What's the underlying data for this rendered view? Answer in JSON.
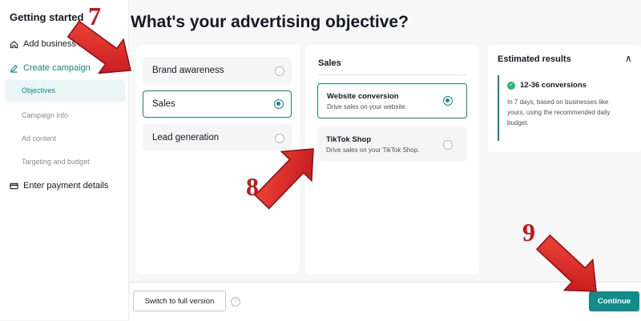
{
  "sidebar": {
    "title": "Getting started",
    "steps": [
      {
        "label": "Add business info",
        "icon": "home-icon"
      },
      {
        "label": "Create campaign",
        "icon": "pencil-icon"
      },
      {
        "label": "Enter payment details",
        "icon": "card-icon"
      }
    ],
    "substeps": [
      "Objectives",
      "Campaign info",
      "Ad content",
      "Targeting and budget"
    ]
  },
  "page": {
    "title": "What's your advertising objective?"
  },
  "objectives": {
    "options": [
      {
        "label": "Brand awareness",
        "selected": false
      },
      {
        "label": "Sales",
        "selected": true
      },
      {
        "label": "Lead generation",
        "selected": false
      }
    ]
  },
  "sales_panel": {
    "title": "Sales",
    "options": [
      {
        "title": "Website conversion",
        "desc": "Drive sales on your website.",
        "selected": true
      },
      {
        "title": "TikTok Shop",
        "desc": "Drive sales on your TikTok Shop.",
        "selected": false
      }
    ]
  },
  "estimated": {
    "title": "Estimated results",
    "head": "12-36 conversions",
    "desc": "In 7 days, based on businesses like yours, using the recommended daily budget."
  },
  "footer": {
    "switch_label": "Switch to full version",
    "continue_label": "Continue"
  },
  "annotations": {
    "n7": "7",
    "n8": "8",
    "n9": "9"
  },
  "colors": {
    "accent": "#128c89",
    "arrow": "#d51f1f",
    "annotation_number": "#c6161b"
  }
}
